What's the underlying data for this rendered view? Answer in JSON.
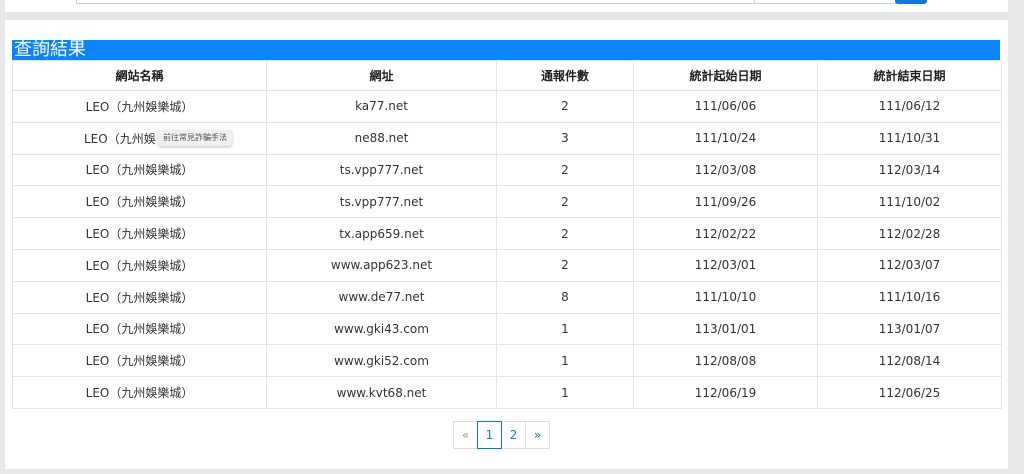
{
  "results": {
    "title": "查詢結果",
    "columns": [
      "網站名稱",
      "網址",
      "通報件數",
      "統計起始日期",
      "統計結束日期"
    ],
    "rows": [
      [
        "LEO（九州娛樂城）",
        "ka77.net",
        "2",
        "111/06/06",
        "111/06/12"
      ],
      [
        "LEO（九州娛",
        "ne88.net",
        "3",
        "111/10/24",
        "111/10/31"
      ],
      [
        "LEO（九州娛樂城）",
        "ts.vpp777.net",
        "2",
        "112/03/08",
        "112/03/14"
      ],
      [
        "LEO（九州娛樂城）",
        "ts.vpp777.net",
        "2",
        "111/09/26",
        "111/10/02"
      ],
      [
        "LEO（九州娛樂城）",
        "tx.app659.net",
        "2",
        "112/02/22",
        "112/02/28"
      ],
      [
        "LEO（九州娛樂城）",
        "www.app623.net",
        "2",
        "112/03/01",
        "112/03/07"
      ],
      [
        "LEO（九州娛樂城）",
        "www.de77.net",
        "8",
        "111/10/10",
        "111/10/16"
      ],
      [
        "LEO（九州娛樂城）",
        "www.gki43.com",
        "1",
        "113/01/01",
        "113/01/07"
      ],
      [
        "LEO（九州娛樂城）",
        "www.gki52.com",
        "1",
        "112/08/08",
        "112/08/14"
      ],
      [
        "LEO（九州娛樂城）",
        "www.kvt68.net",
        "1",
        "112/06/19",
        "112/06/25"
      ]
    ]
  },
  "tooltip": {
    "text": "前往常見詐騙手法"
  },
  "pagination": {
    "prev": "«",
    "pages": [
      "1",
      "2"
    ],
    "next": "»",
    "active": "1"
  }
}
